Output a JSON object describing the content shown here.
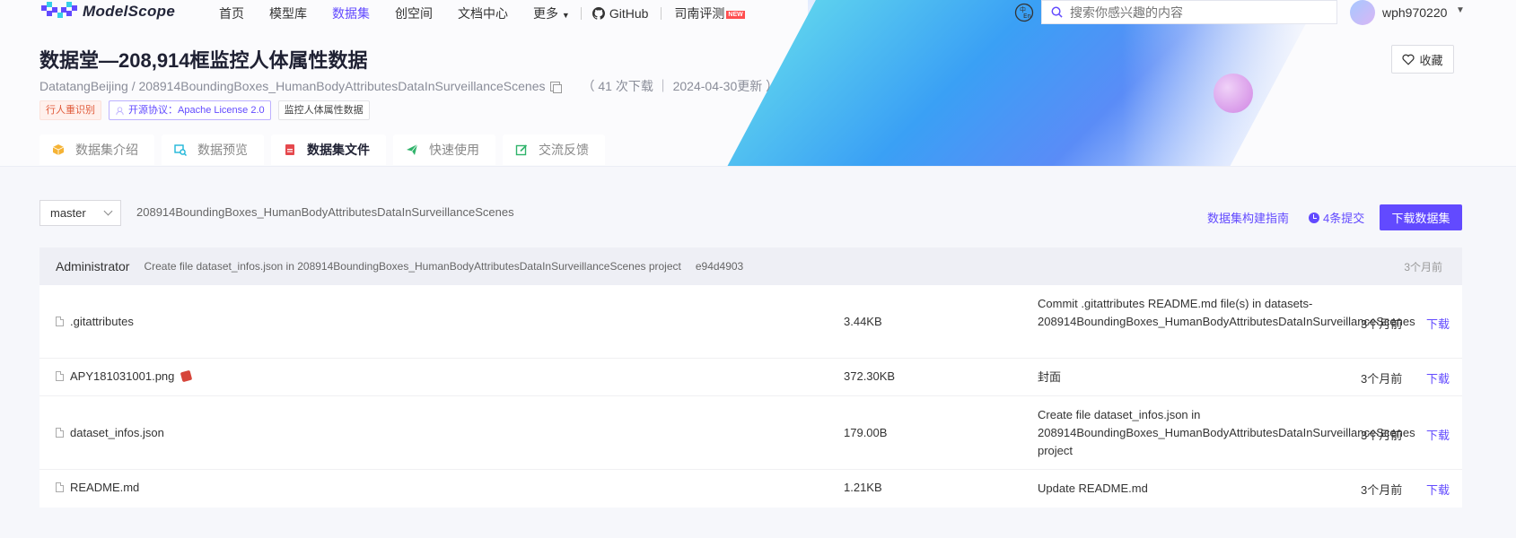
{
  "nav": {
    "logo_text": "ModelScope",
    "links": [
      "首页",
      "模型库",
      "数据集",
      "创空间",
      "文档中心"
    ],
    "more": "更多",
    "github": "GitHub",
    "eval": "司南评测",
    "new_badge": "NEW",
    "search_placeholder": "搜索你感兴趣的内容",
    "username": "wph970220"
  },
  "header": {
    "title": "数据堂—208,914框监控人体属性数据",
    "path": "DatatangBeijing / 208914BoundingBoxes_HumanBodyAttributesDataInSurveillanceScenes",
    "meta": "（ 41 次下载 ｜ 2024-04-30更新 ）",
    "tags": [
      "行人重识别",
      "开源协议：Apache License 2.0",
      "监控人体属性数据"
    ],
    "favorite": "收藏"
  },
  "tabs": [
    "数据集介绍",
    "数据预览",
    "数据集文件",
    "快速使用",
    "交流反馈"
  ],
  "toolbar": {
    "branch": "master",
    "crumb": "208914BoundingBoxes_HumanBodyAttributesDataInSurveillanceScenes",
    "guide": "数据集构建指南",
    "commits": "4条提交",
    "download": "下载数据集"
  },
  "commit": {
    "author": "Administrator",
    "message": "Create file dataset_infos.json in 208914BoundingBoxes_HumanBodyAttributesDataInSurveillanceScenes project",
    "hash": "e94d4903",
    "time": "3个月前"
  },
  "files": [
    {
      "name": ".gitattributes",
      "size": "3.44KB",
      "message": "Commit .gitattributes README.md file(s) in datasets-208914BoundingBoxes_HumanBodyAttributesDataInSurveillanceScenes",
      "time": "3个月前",
      "action": "下载"
    },
    {
      "name": "APY181031001.png",
      "size": "372.30KB",
      "message": "封面",
      "time": "3个月前",
      "action": "下载"
    },
    {
      "name": "dataset_infos.json",
      "size": "179.00B",
      "message": "Create file dataset_infos.json in 208914BoundingBoxes_HumanBodyAttributesDataInSurveillanceScenes project",
      "time": "3个月前",
      "action": "下载"
    },
    {
      "name": "README.md",
      "size": "1.21KB",
      "message": "Update README.md",
      "time": "3个月前",
      "action": "下载"
    }
  ],
  "colors": {
    "accent": "#624aff",
    "tag_red": "#e05a3a"
  }
}
